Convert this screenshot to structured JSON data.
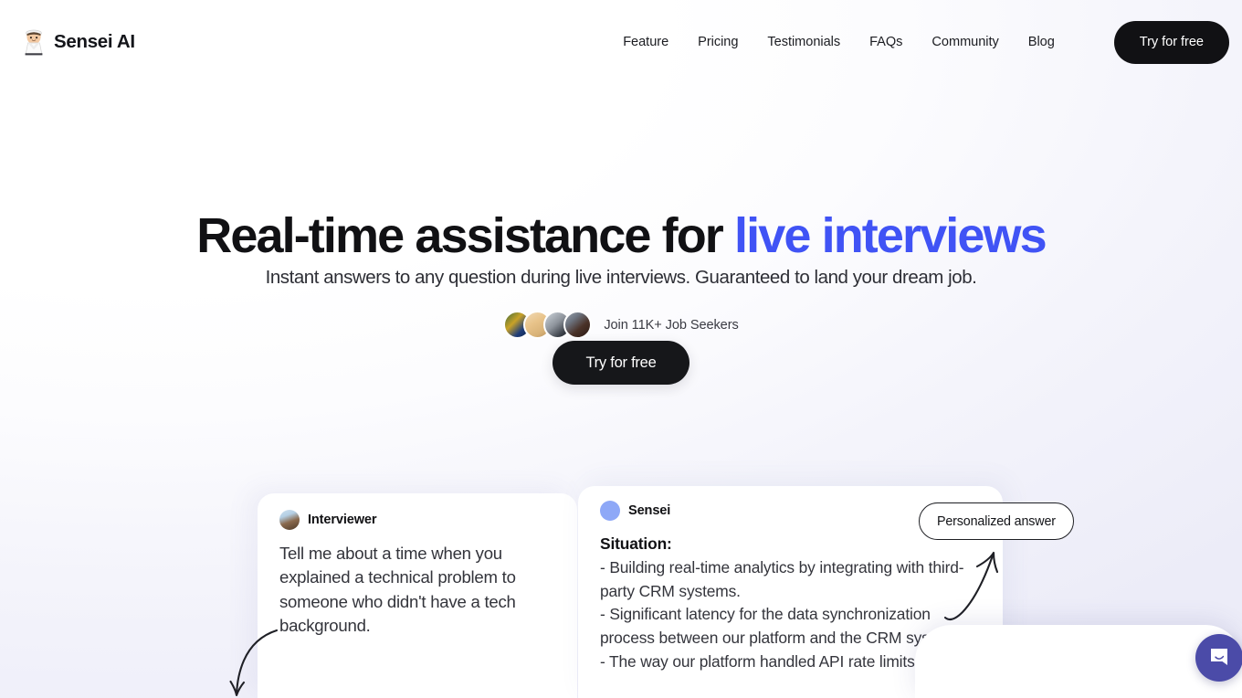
{
  "brand": {
    "name": "Sensei AI",
    "icon": "sensei-mascot-icon"
  },
  "nav": {
    "links": [
      {
        "label": "Feature"
      },
      {
        "label": "Pricing"
      },
      {
        "label": "Testimonials"
      },
      {
        "label": "FAQs"
      },
      {
        "label": "Community"
      },
      {
        "label": "Blog"
      }
    ],
    "cta_label": "Try for free"
  },
  "hero": {
    "headline_plain": "Real-time assistance for ",
    "headline_accent": "live interviews",
    "subhead": "Instant answers to any question during live interviews. Guaranteed to land your dream job.",
    "social_proof": "Join 11K+ Job Seekers",
    "cta_label": "Try for free",
    "accent_color": "#4053f5"
  },
  "conversation": {
    "interviewer": {
      "name": "Interviewer",
      "avatar": "interviewer-photo-avatar",
      "message": "Tell me about a time when you explained a technical problem to someone who didn't have a tech background."
    },
    "sensei": {
      "name": "Sensei",
      "avatar": "sensei-circle-avatar",
      "section_label": "Situation:",
      "bullets": [
        "-  Building real-time analytics by integrating with third-party CRM systems.",
        "-  Significant latency for the data synchronization process between our platform and the CRM systems",
        "-  The way our platform handled API rate limits and"
      ]
    },
    "badge_label": "Personalized answer"
  },
  "chat_widget": {
    "icon": "chat-message-icon",
    "accent_color": "#4b4ba8"
  }
}
